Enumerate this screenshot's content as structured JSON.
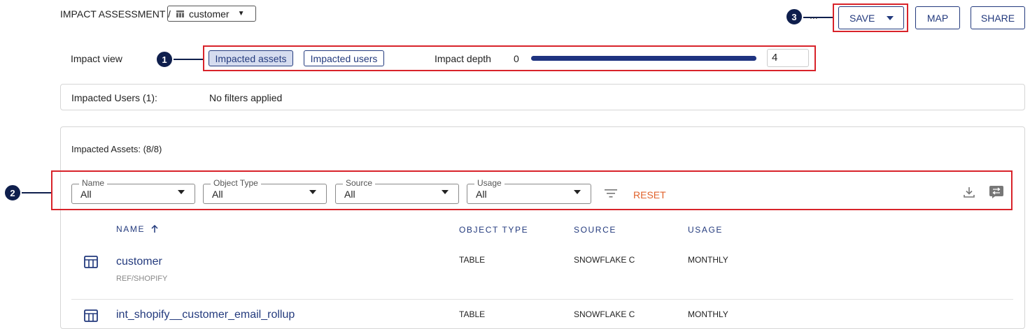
{
  "breadcrumb": {
    "root": "IMPACT ASSESSMENT /",
    "selected": "customer"
  },
  "toolbar": {
    "more": "...",
    "save_label": "SAVE",
    "map_label": "MAP",
    "share_label": "SHARE"
  },
  "annotations": [
    "1",
    "2",
    "3"
  ],
  "impact_view": {
    "label": "Impact view",
    "options": [
      "Impacted assets",
      "Impacted users"
    ],
    "selected_index": 0,
    "depth_label": "Impact depth",
    "depth_min": "0",
    "depth_value": "4",
    "depth_fraction": 1.0
  },
  "users_panel": {
    "title": "Impacted Users (1):",
    "filters_text": "No filters applied"
  },
  "assets_panel": {
    "title": "Impacted Assets: (8/8)",
    "filters": [
      {
        "label": "Name",
        "value": "All"
      },
      {
        "label": "Object Type",
        "value": "All"
      },
      {
        "label": "Source",
        "value": "All"
      },
      {
        "label": "Usage",
        "value": "All"
      }
    ],
    "reset_label": "RESET",
    "columns": {
      "name": "NAME",
      "object_type": "OBJECT TYPE",
      "source": "SOURCE",
      "usage": "USAGE"
    },
    "rows": [
      {
        "name": "customer",
        "path": "REF/SHOPIFY",
        "object_type": "TABLE",
        "source": "SNOWFLAKE C",
        "usage": "MONTHLY"
      },
      {
        "name": "int_shopify__customer_email_rollup",
        "path": "",
        "object_type": "TABLE",
        "source": "SNOWFLAKE C",
        "usage": "MONTHLY"
      }
    ]
  },
  "colors": {
    "accent": "#233a7d",
    "highlight": "#d8232a",
    "badge": "#0f1f4d",
    "reset": "#e0622b"
  }
}
